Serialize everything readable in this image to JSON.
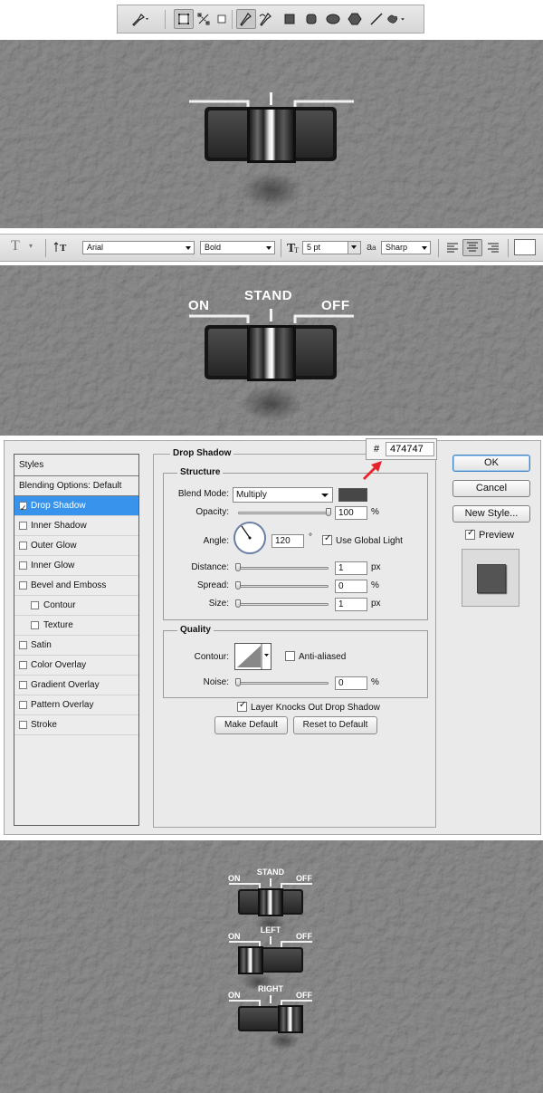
{
  "pen_toolbar": {
    "icons": [
      "pen-tool-icon",
      "shape-layers-icon",
      "paths-icon",
      "fill-pixels-icon",
      "pen-icon",
      "freeform-pen-icon",
      "rectangle-icon",
      "rounded-rectangle-icon",
      "ellipse-icon",
      "polygon-icon",
      "line-icon",
      "custom-shape-icon"
    ]
  },
  "switch1": {},
  "type_toolbar": {
    "font_family": "Arial",
    "font_style": "Bold",
    "font_size": "5 pt",
    "aa_label": "a",
    "aa_label2": "a",
    "antialias": "Sharp",
    "color": "#ffffff"
  },
  "switch2": {
    "on": "ON",
    "stand": "STAND",
    "off": "OFF"
  },
  "dialog": {
    "styles_header": "Styles",
    "blending_options": "Blending Options: Default",
    "styles": [
      {
        "label": "Drop Shadow",
        "checked": true,
        "selected": true
      },
      {
        "label": "Inner Shadow",
        "checked": false
      },
      {
        "label": "Outer Glow",
        "checked": false
      },
      {
        "label": "Inner Glow",
        "checked": false
      },
      {
        "label": "Bevel and Emboss",
        "checked": false
      },
      {
        "label": "Contour",
        "checked": false,
        "indent": true
      },
      {
        "label": "Texture",
        "checked": false,
        "indent": true
      },
      {
        "label": "Satin",
        "checked": false
      },
      {
        "label": "Color Overlay",
        "checked": false
      },
      {
        "label": "Gradient Overlay",
        "checked": false
      },
      {
        "label": "Pattern Overlay",
        "checked": false
      },
      {
        "label": "Stroke",
        "checked": false
      }
    ],
    "section_title": "Drop Shadow",
    "structure": {
      "title": "Structure",
      "blend_mode_label": "Blend Mode:",
      "blend_mode": "Multiply",
      "blend_color": "#474747",
      "opacity_label": "Opacity:",
      "opacity": "100",
      "opacity_fraction": 1.0,
      "percent": "%",
      "angle_label": "Angle:",
      "angle": "120",
      "degree": "°",
      "use_global_light": "Use Global Light",
      "distance_label": "Distance:",
      "distance": "1",
      "spread_label": "Spread:",
      "spread": "0",
      "size_label": "Size:",
      "size": "1",
      "px": "px"
    },
    "quality": {
      "title": "Quality",
      "contour_label": "Contour:",
      "anti_aliased": "Anti-aliased",
      "noise_label": "Noise:",
      "noise": "0",
      "percent": "%"
    },
    "layer_knocks_out": "Layer Knocks Out Drop Shadow",
    "make_default": "Make Default",
    "reset_default": "Reset to Default",
    "ok": "OK",
    "cancel": "Cancel",
    "new_style": "New Style...",
    "preview": "Preview"
  },
  "color_picker": {
    "hash": "#",
    "hex": "474747"
  },
  "final_panel": {
    "switches": [
      {
        "on": "ON",
        "center": "STAND",
        "off": "OFF",
        "state": "stand"
      },
      {
        "on": "ON",
        "center": "LEFT",
        "off": "OFF",
        "state": "left"
      },
      {
        "on": "ON",
        "center": "RIGHT",
        "off": "OFF",
        "state": "right"
      }
    ]
  }
}
